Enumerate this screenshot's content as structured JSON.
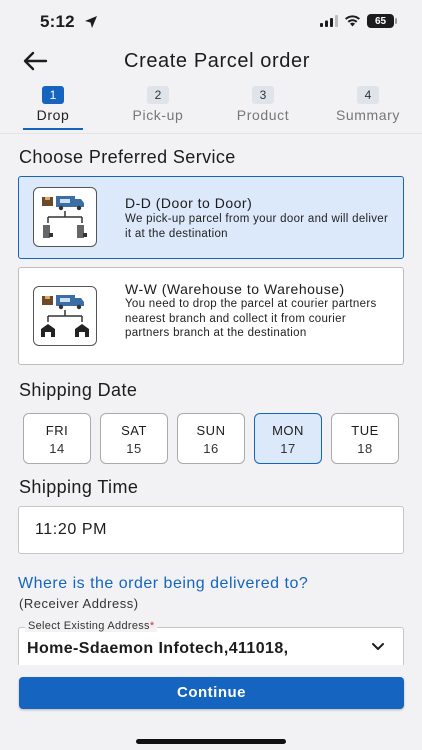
{
  "status_bar": {
    "time": "5:12",
    "battery": "65"
  },
  "header": {
    "title": "Create Parcel order"
  },
  "steps": [
    {
      "num": "1",
      "label": "Drop"
    },
    {
      "num": "2",
      "label": "Pick-up"
    },
    {
      "num": "3",
      "label": "Product"
    },
    {
      "num": "4",
      "label": "Summary"
    }
  ],
  "service": {
    "heading": "Choose Preferred Service",
    "options": [
      {
        "title": "D-D (Door to Door)",
        "desc": "We pick-up parcel from your door and will deliver it at the destination"
      },
      {
        "title": "W-W (Warehouse to Warehouse)",
        "desc": "You need to drop the parcel at courier partners nearest branch and collect it from courier partners branch at the destination"
      }
    ]
  },
  "shipping_date": {
    "heading": "Shipping Date",
    "dates": [
      {
        "day": "FRI",
        "num": "14"
      },
      {
        "day": "SAT",
        "num": "15"
      },
      {
        "day": "SUN",
        "num": "16"
      },
      {
        "day": "MON",
        "num": "17"
      },
      {
        "day": "TUE",
        "num": "18"
      }
    ]
  },
  "shipping_time": {
    "heading": "Shipping Time",
    "value": "11:20 PM"
  },
  "delivery": {
    "question": "Where is the order being delivered to?",
    "sub": "(Receiver Address)",
    "select_label": "Select Existing Address",
    "required_mark": "*",
    "value": "Home-Sdaemon Infotech,411018,"
  },
  "footer": {
    "continue_label": "Continue"
  },
  "colors": {
    "accent": "#1565c0",
    "selected_bg": "#dce9fa",
    "required": "#d32f2f"
  },
  "icons": [
    "location-arrow-icon",
    "signal-icon",
    "wifi-icon",
    "battery-icon",
    "back-arrow-icon",
    "door-to-door-icon",
    "warehouse-icon",
    "chevron-down-icon"
  ]
}
